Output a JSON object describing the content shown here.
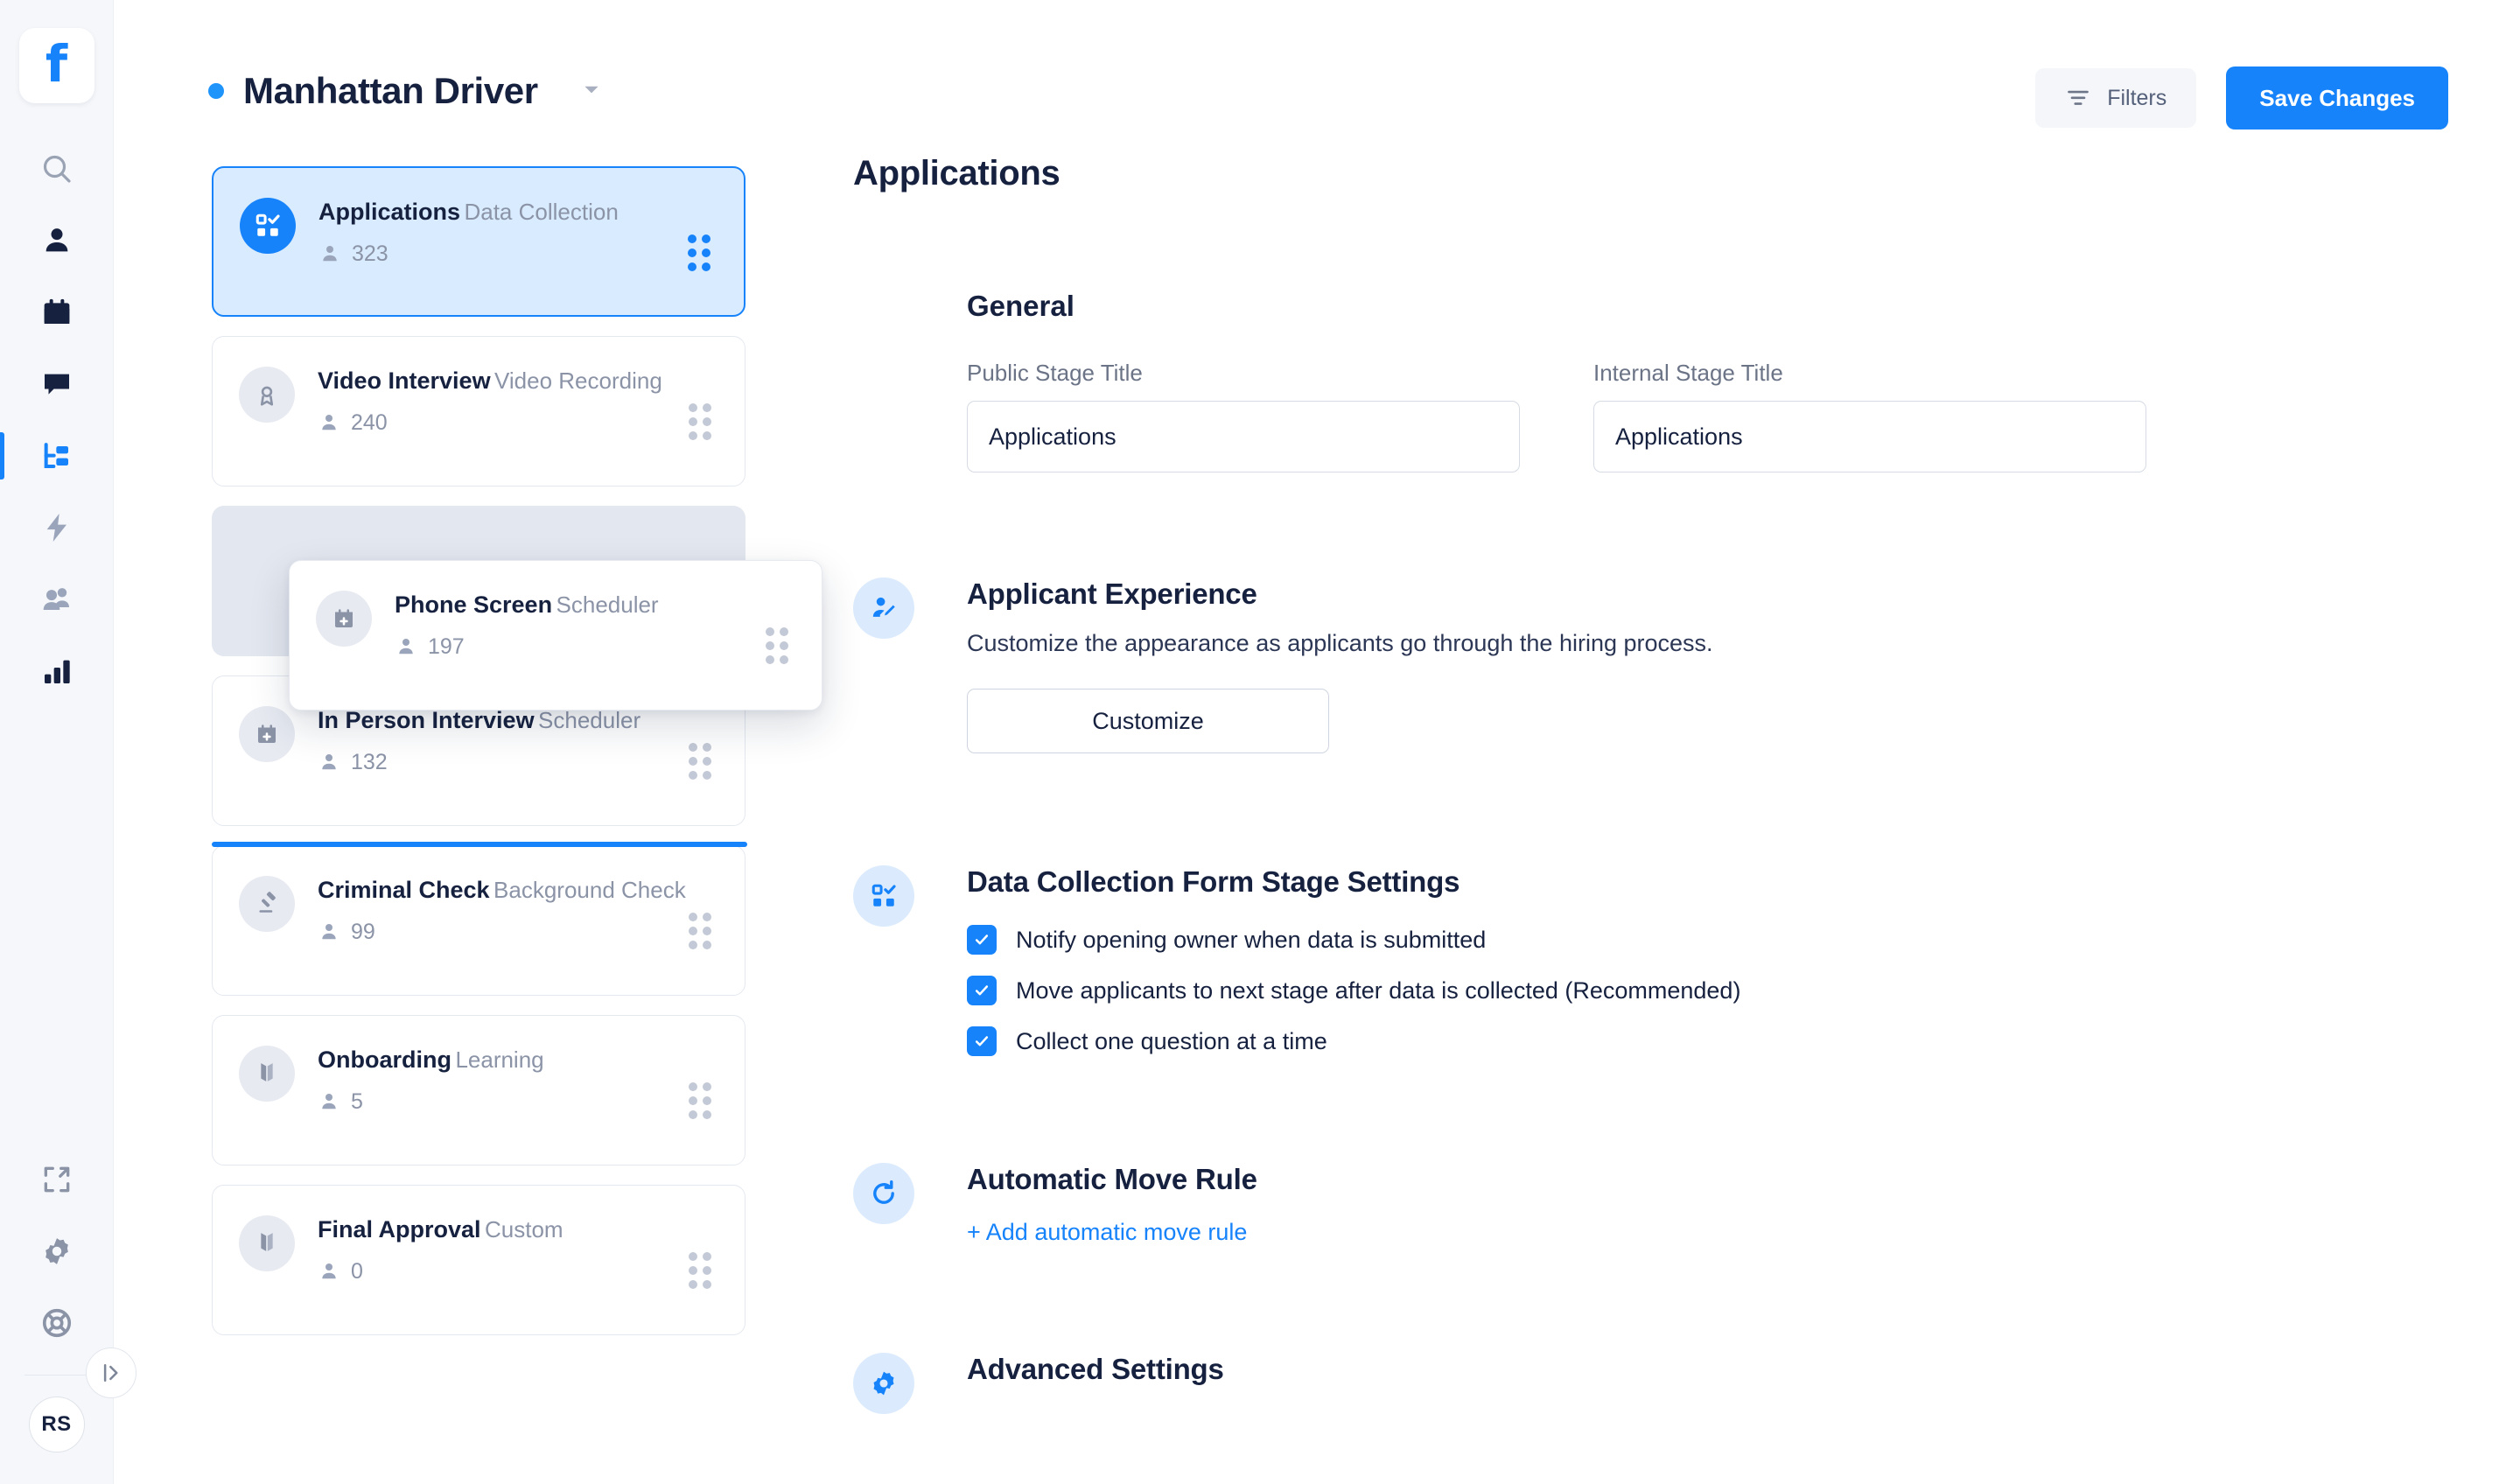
{
  "rail": {
    "logo_glyph": "f",
    "items": [
      {
        "name": "search-icon",
        "active": false
      },
      {
        "name": "person-icon",
        "active": false
      },
      {
        "name": "calendar-icon",
        "active": false
      },
      {
        "name": "chat-bubble-icon",
        "active": false
      },
      {
        "name": "pipeline-icon",
        "active": true
      },
      {
        "name": "lightning-bolt-icon",
        "active": false
      },
      {
        "name": "people-group-icon",
        "active": false
      },
      {
        "name": "bar-chart-icon",
        "active": false
      }
    ],
    "bottom_items": [
      {
        "name": "expand-icon"
      },
      {
        "name": "gear-icon"
      },
      {
        "name": "lifebuoy-icon"
      }
    ],
    "collapse_icon": "collapse-panel-icon",
    "avatar_initials": "RS"
  },
  "header": {
    "title": "Manhattan Driver",
    "status_dot_color": "#1f94fb",
    "caret_icon": "chevron-down-icon",
    "filters_label": "Filters",
    "filters_icon": "filter-icon",
    "save_label": "Save Changes",
    "save_color": "#1683fb"
  },
  "stages": [
    {
      "name": "Applications",
      "type": "Data Collection",
      "count": "323",
      "icon": "data-collection-icon",
      "state": "selected"
    },
    {
      "name": "Video Interview",
      "type": "Video Recording",
      "count": "240",
      "icon": "video-badge-icon",
      "state": "normal"
    },
    {
      "name": "",
      "type": "",
      "count": "",
      "icon": "",
      "state": "placeholder"
    },
    {
      "name": "In Person Interview",
      "type": "Scheduler",
      "count": "132",
      "icon": "calendar-plus-icon",
      "state": "normal"
    },
    {
      "name": "Criminal Check",
      "type": "Background Check",
      "count": "99",
      "icon": "gavel-icon",
      "state": "normal"
    },
    {
      "name": "Onboarding",
      "type": "Learning",
      "count": "5",
      "icon": "book-icon",
      "state": "normal"
    },
    {
      "name": "Final Approval",
      "type": "Custom",
      "count": "0",
      "icon": "book-icon",
      "state": "normal"
    }
  ],
  "drag_card": {
    "name": "Phone Screen",
    "type": "Scheduler",
    "count": "197",
    "icon": "calendar-plus-icon"
  },
  "drop_indicator_color": "#1683fb",
  "panel": {
    "title": "Applications",
    "general": {
      "heading": "General",
      "public_title_label": "Public Stage Title",
      "public_title_value": "Applications",
      "internal_title_label": "Internal Stage Title",
      "internal_title_value": "Applications"
    },
    "applicant_experience": {
      "icon": "applicant-edit-icon",
      "heading": "Applicant Experience",
      "description": "Customize the appearance as applicants go through the hiring process.",
      "button_label": "Customize"
    },
    "data_collection": {
      "icon": "data-collection-icon",
      "heading": "Data Collection Form Stage Settings",
      "options": [
        {
          "label": "Notify opening owner when data is submitted",
          "checked": true
        },
        {
          "label": "Move applicants to next stage after data is collected (Recommended)",
          "checked": true
        },
        {
          "label": "Collect one question at a time",
          "checked": true
        }
      ]
    },
    "automatic_move_rule": {
      "icon": "refresh-icon",
      "heading": "Automatic Move Rule",
      "add_link": "+ Add automatic move rule"
    },
    "advanced_settings": {
      "icon": "gear-icon",
      "heading": "Advanced Settings"
    }
  }
}
